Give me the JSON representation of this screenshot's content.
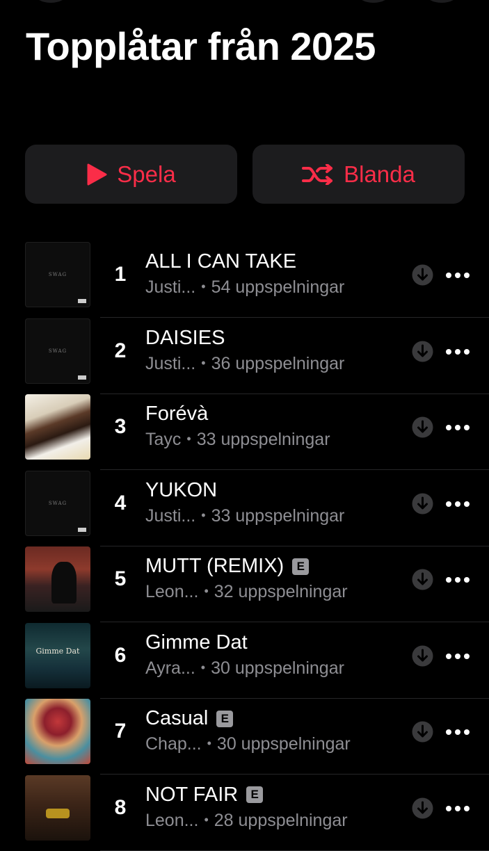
{
  "header": {
    "title": "Topplåtar från 2025"
  },
  "actions": {
    "play_label": "Spela",
    "shuffle_label": "Blanda"
  },
  "colors": {
    "accent": "#fa2d48",
    "background": "#000000",
    "secondary_text": "#8e8e93",
    "button_bg": "#1c1c1e"
  },
  "icons": {
    "play": "play-icon",
    "shuffle": "shuffle-icon",
    "download": "download-icon",
    "more": "more-icon",
    "explicit": "explicit-badge"
  },
  "tracks": [
    {
      "rank": "1",
      "title": "ALL I CAN TAKE",
      "artist": "Justi...",
      "plays": "54 uppspelningar",
      "explicit": false,
      "art_text": "SWAG"
    },
    {
      "rank": "2",
      "title": "DAISIES",
      "artist": "Justi...",
      "plays": "36 uppspelningar",
      "explicit": false,
      "art_text": "SWAG"
    },
    {
      "rank": "3",
      "title": "Forévà",
      "artist": "Tayc",
      "plays": "33 uppspelningar",
      "explicit": false
    },
    {
      "rank": "4",
      "title": "YUKON",
      "artist": "Justi...",
      "plays": "33 uppspelningar",
      "explicit": false,
      "art_text": "SWAG"
    },
    {
      "rank": "5",
      "title": "MUTT (REMIX)",
      "artist": "Leon...",
      "plays": "32 uppspelningar",
      "explicit": true,
      "explicit_label": "E"
    },
    {
      "rank": "6",
      "title": "Gimme Dat",
      "artist": "Ayra...",
      "plays": "30 uppspelningar",
      "explicit": false,
      "art_text": "Gimme Dat"
    },
    {
      "rank": "7",
      "title": "Casual",
      "artist": "Chap...",
      "plays": "30 uppspelningar",
      "explicit": true,
      "explicit_label": "E"
    },
    {
      "rank": "8",
      "title": "NOT FAIR",
      "artist": "Leon...",
      "plays": "28 uppspelningar",
      "explicit": true,
      "explicit_label": "E"
    }
  ]
}
